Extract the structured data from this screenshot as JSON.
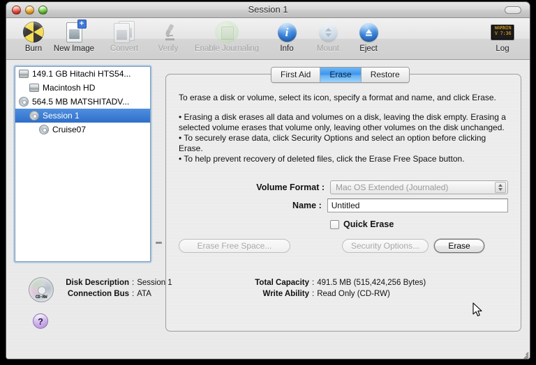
{
  "window": {
    "title": "Session 1",
    "controls": {
      "close": "close",
      "minimize": "minimize",
      "zoom": "zoom"
    },
    "toolbar_toggle_label": ""
  },
  "toolbar": {
    "items": [
      {
        "label": "Burn",
        "icon": "burn-icon",
        "enabled": true
      },
      {
        "label": "New Image",
        "icon": "new-image-icon",
        "enabled": true
      },
      {
        "label": "Convert",
        "icon": "convert-icon",
        "enabled": false
      },
      {
        "label": "Verify",
        "icon": "verify-icon",
        "enabled": false
      },
      {
        "label": "Enable Journaling",
        "icon": "enable-journaling-icon",
        "enabled": false
      },
      {
        "label": "Info",
        "icon": "info-icon",
        "enabled": true
      },
      {
        "label": "Mount",
        "icon": "mount-icon",
        "enabled": false
      },
      {
        "label": "Eject",
        "icon": "eject-icon",
        "enabled": true
      }
    ],
    "log": {
      "label": "Log",
      "icon": "log-icon",
      "screen_line1": "WARNIN",
      "screen_line2": "V 7:36"
    }
  },
  "sidebar": {
    "items": [
      {
        "label": "149.1 GB Hitachi HTS54...",
        "icon": "hard-disk-icon",
        "indent": 0,
        "selected": false
      },
      {
        "label": "Macintosh HD",
        "icon": "hard-disk-icon",
        "indent": 1,
        "selected": false
      },
      {
        "label": "564.5 MB MATSHITADV...",
        "icon": "optical-disc-icon",
        "indent": 0,
        "selected": false
      },
      {
        "label": "Session 1",
        "icon": "optical-disc-icon",
        "indent": 1,
        "selected": true
      },
      {
        "label": "Cruise07",
        "icon": "optical-disc-icon",
        "indent": 2,
        "selected": false
      }
    ]
  },
  "tabs": [
    {
      "label": "First Aid",
      "active": false
    },
    {
      "label": "Erase",
      "active": true
    },
    {
      "label": "Restore",
      "active": false
    }
  ],
  "description": {
    "intro": "To erase a disk or volume, select its icon, specify a format and name, and click Erase.",
    "bullets": [
      "• Erasing a disk erases all data and volumes on a disk, leaving the disk empty. Erasing a selected volume erases that volume only, leaving other volumes on the disk unchanged.",
      "• To securely erase data, click Security Options and select an option before clicking Erase.",
      "• To help prevent recovery of deleted files, click the Erase Free Space button."
    ]
  },
  "form": {
    "volume_format_label": "Volume Format :",
    "volume_format_value": "Mac OS Extended (Journaled)",
    "volume_format_enabled": false,
    "name_label": "Name :",
    "name_value": "Untitled",
    "name_placeholder": "Untitled",
    "quick_erase_label": "Quick Erase",
    "quick_erase_checked": false
  },
  "buttons": {
    "erase_free_space": {
      "label": "Erase Free Space...",
      "enabled": false
    },
    "security_options": {
      "label": "Security Options...",
      "enabled": false
    },
    "erase": {
      "label": "Erase",
      "enabled": true,
      "default": true
    }
  },
  "info": {
    "disc_icon_label": "CD-RW",
    "left": [
      {
        "key": "Disk Description",
        "sep": ":",
        "value": "Session 1"
      },
      {
        "key": "Connection Bus",
        "sep": ":",
        "value": "ATA"
      }
    ],
    "right": [
      {
        "key": "Total Capacity",
        "sep": ":",
        "value": "491.5 MB (515,424,256 Bytes)"
      },
      {
        "key": "Write Ability",
        "sep": ":",
        "value": "Read Only (CD-RW)"
      }
    ]
  },
  "help": {
    "label": "?"
  },
  "colors": {
    "selection_blue": "#2f6fc9",
    "tab_active_blue": "#3d95ef",
    "focus_ring": "#89b4de",
    "log_text_orange": "#f0a81e",
    "help_purple": "#cdb0ea"
  }
}
